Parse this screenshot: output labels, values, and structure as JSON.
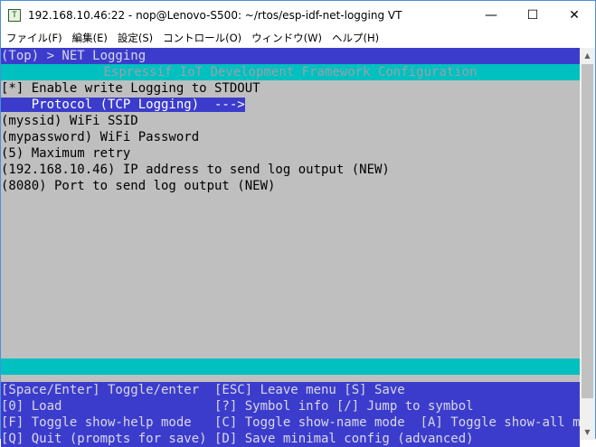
{
  "window": {
    "title": "192.168.10.46:22 - nop@Lenovo-S500: ~/rtos/esp-idf-net-logging VT",
    "app_icon": "T",
    "minimize": "—",
    "maximize": "☐",
    "close": "✕"
  },
  "menu": [
    "ファイル(F)",
    "編集(E)",
    "設定(S)",
    "コントロール(O)",
    "ウィンドウ(W)",
    "ヘルプ(H)"
  ],
  "terminal": {
    "breadcrumb": "(Top) > NET Logging",
    "header": "Espressif IoT Development Framework Configuration",
    "lines": [
      "[*] Enable write Logging to STDOUT",
      "    Protocol (TCP Logging)  --->",
      "(myssid) WiFi SSID",
      "(mypassword) WiFi Password",
      "(5) Maximum retry",
      "(192.168.10.46) IP address to send log output (NEW)",
      "(8080) Port to send log output (NEW)"
    ],
    "help_lines": [
      "[Space/Enter] Toggle/enter  [ESC] Leave menu [S] Save",
      "[0] Load                    [?] Symbol info [/] Jump to symbol",
      "[F] Toggle show-help mode   [C] Toggle show-name mode  [A] Toggle show-all mode",
      "[Q] Quit (prompts for save) [D] Save minimal config (advanced)"
    ]
  },
  "colors": {
    "terminal_bg": "#bfbfbf",
    "highlight_blue": "#3c3ccc",
    "header_cyan": "#00c0c0"
  }
}
